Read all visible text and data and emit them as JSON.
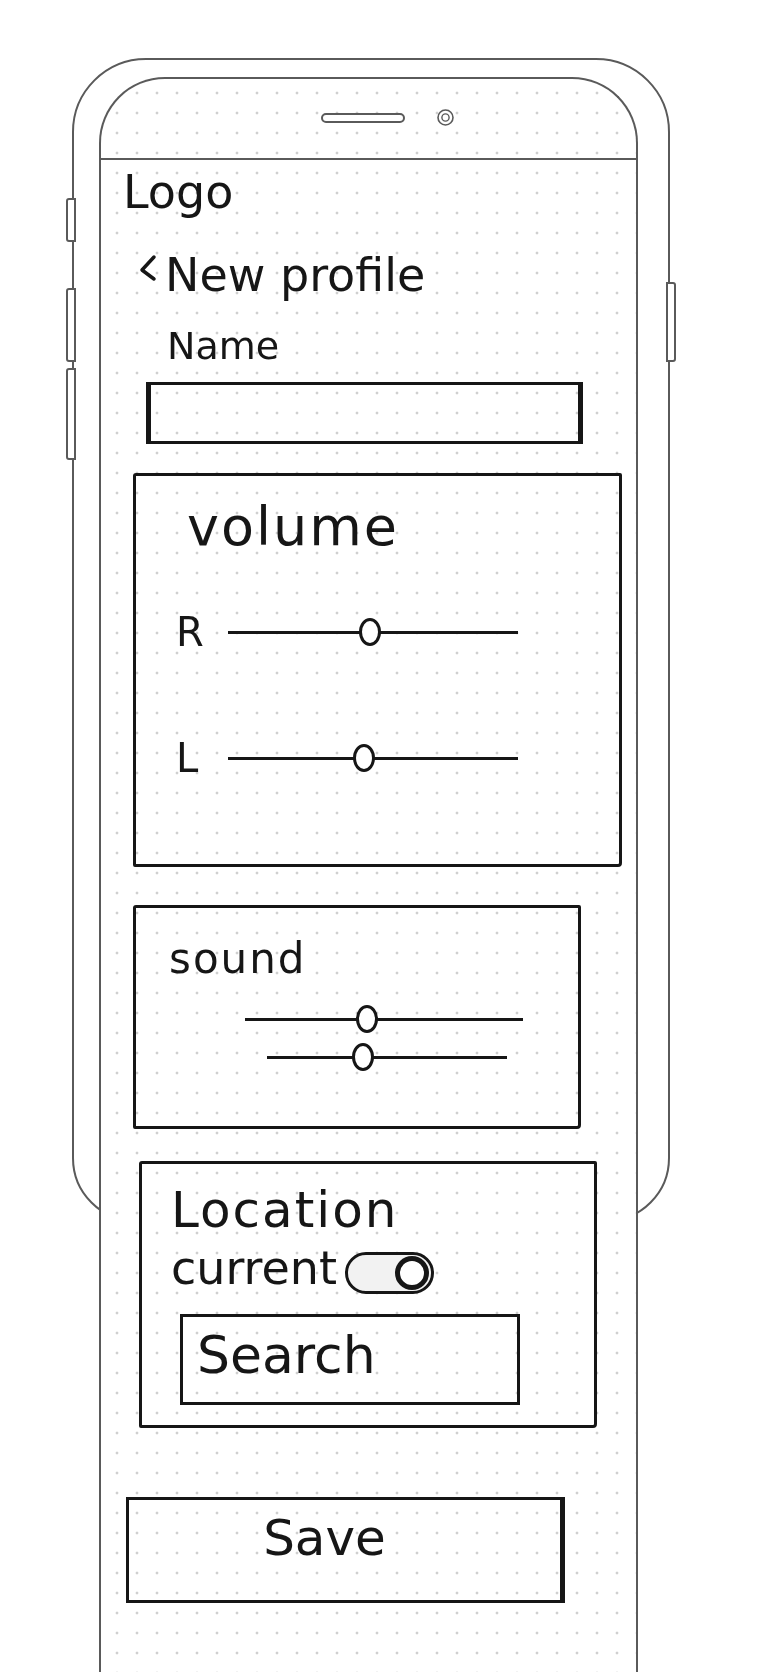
{
  "header": {
    "logo": "Logo",
    "title": "New profile"
  },
  "name_field": {
    "label": "Name"
  },
  "volume": {
    "title": "volume",
    "channels": [
      {
        "label": "R",
        "level": 0.49
      },
      {
        "label": "L",
        "level": 0.47
      }
    ]
  },
  "sound": {
    "title": "sound",
    "sliders": [
      {
        "level": 0.44
      },
      {
        "level": 0.4
      }
    ]
  },
  "location": {
    "title": "Location",
    "current": {
      "label": "current",
      "on": true
    },
    "search": {
      "placeholder": "Search"
    }
  },
  "save_button": {
    "label": "Save"
  }
}
